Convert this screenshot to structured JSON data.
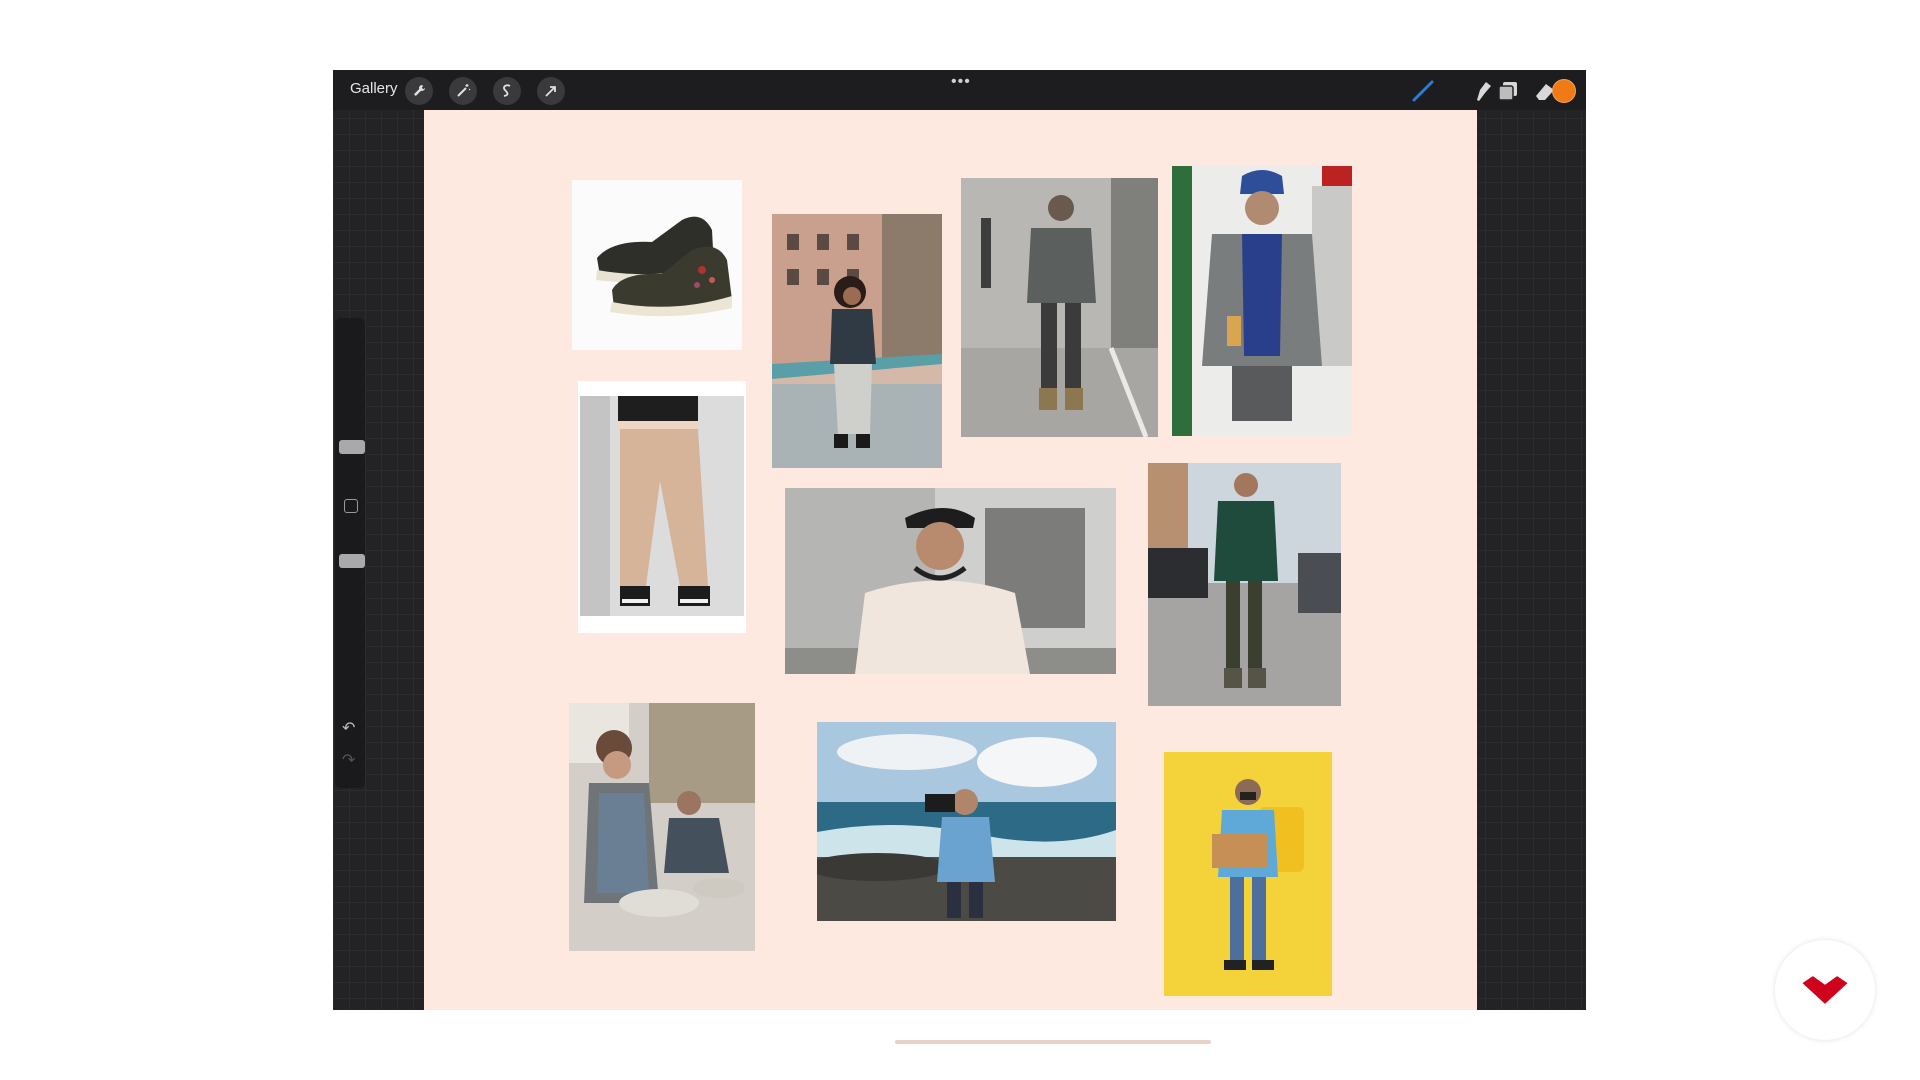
{
  "topbar": {
    "gallery_label": "Gallery",
    "left_tools": [
      "wrench-icon",
      "magic-wand-icon",
      "selection-icon",
      "transform-arrow-icon"
    ],
    "more_label": "•••",
    "right_tools": [
      "brush-icon",
      "smudge-icon",
      "eraser-icon",
      "layers-icon"
    ],
    "current_color": "#f07a13"
  },
  "sidebar": {
    "undo_glyph": "↶",
    "redo_glyph": "↷"
  },
  "canvas": {
    "background": "#fde9e0",
    "photos": [
      "sneakers-photo",
      "woman-denim-jacket-photo",
      "man-walking-street-photo",
      "man-varsity-jacket-photo",
      "cargo-pants-photo",
      "man-headphones-photo",
      "man-green-jacket-street-photo",
      "pottery-studio-photo",
      "man-camera-beach-photo",
      "delivery-man-yellow-photo"
    ]
  },
  "brand": {
    "accent": "#d0021b"
  }
}
